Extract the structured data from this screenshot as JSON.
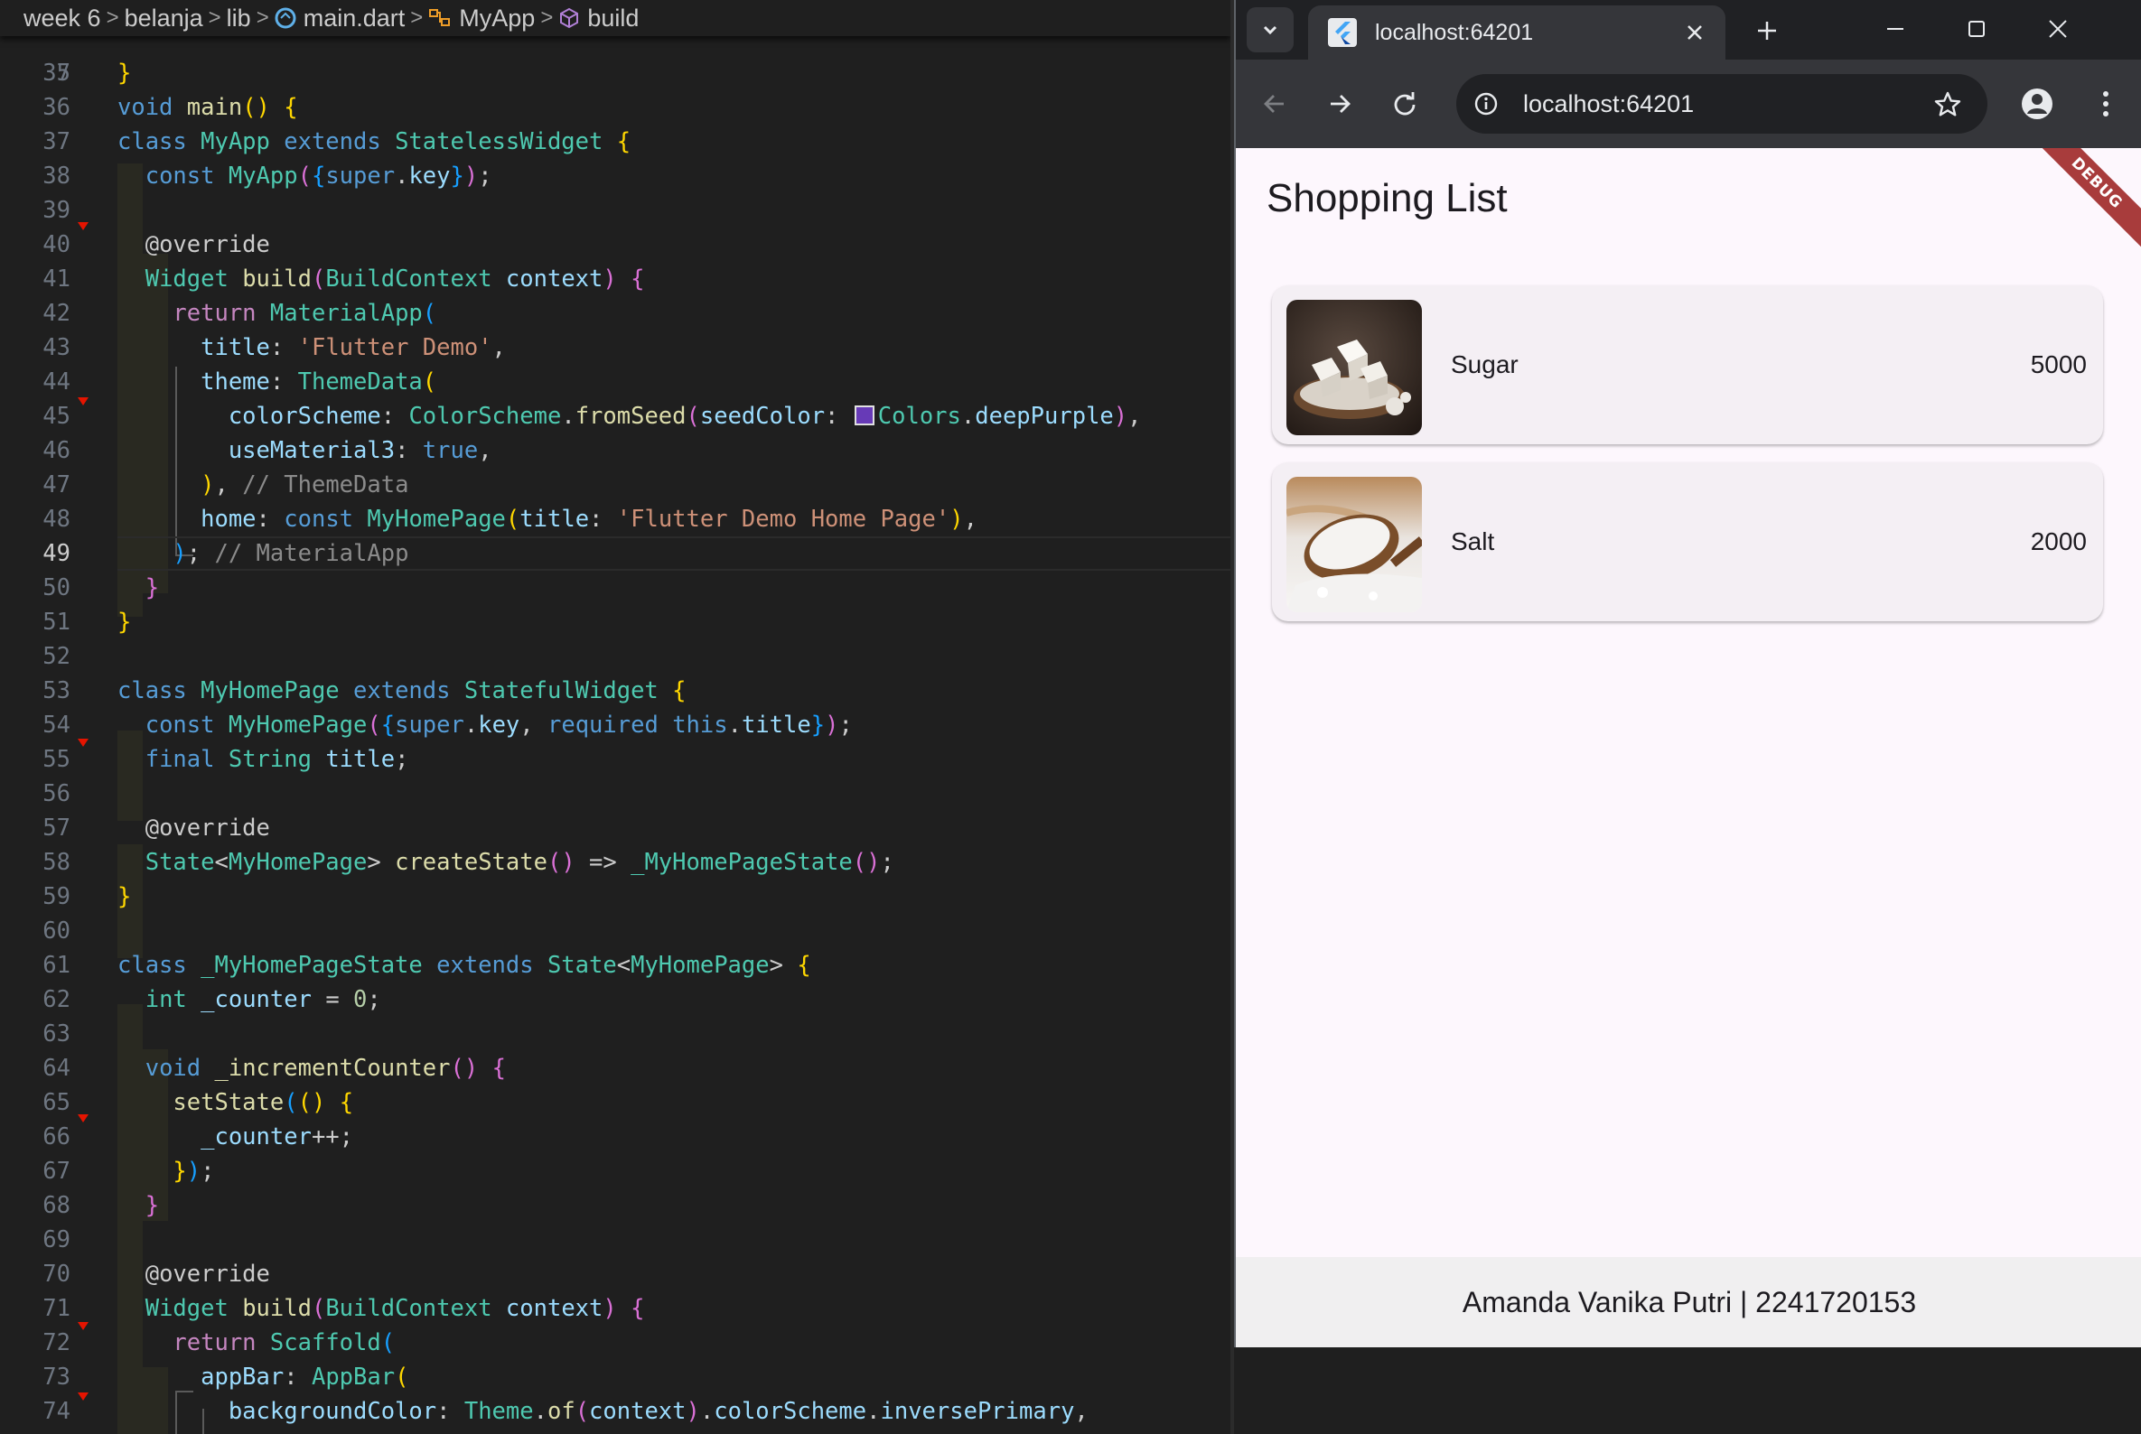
{
  "editor": {
    "breadcrumb": [
      "week 6",
      "belanja",
      "lib",
      "main.dart",
      "MyApp",
      "build"
    ],
    "partial_top_line": {
      "number": "7",
      "text": "void main() {"
    },
    "current_line": 49,
    "lines": [
      {
        "n": 35,
        "text": "}"
      },
      {
        "n": 36,
        "text": ""
      },
      {
        "n": 37,
        "text": "class MyApp extends StatelessWidget {"
      },
      {
        "n": 38,
        "text": "  const MyApp({super.key});"
      },
      {
        "n": 39,
        "text": ""
      },
      {
        "n": 40,
        "text": "  @override"
      },
      {
        "n": 41,
        "text": "  Widget build(BuildContext context) {"
      },
      {
        "n": 42,
        "text": "    return MaterialApp("
      },
      {
        "n": 43,
        "text": "      title: 'Flutter Demo',"
      },
      {
        "n": 44,
        "text": "      theme: ThemeData("
      },
      {
        "n": 45,
        "text": "        colorScheme: ColorScheme.fromSeed(seedColor: Colors.deepPurple),"
      },
      {
        "n": 46,
        "text": "        useMaterial3: true,"
      },
      {
        "n": 47,
        "text": "      ), // ThemeData"
      },
      {
        "n": 48,
        "text": "      home: const MyHomePage(title: 'Flutter Demo Home Page'),"
      },
      {
        "n": 49,
        "text": "    ); // MaterialApp"
      },
      {
        "n": 50,
        "text": "  }"
      },
      {
        "n": 51,
        "text": "}"
      },
      {
        "n": 52,
        "text": ""
      },
      {
        "n": 53,
        "text": "class MyHomePage extends StatefulWidget {"
      },
      {
        "n": 54,
        "text": "  const MyHomePage({super.key, required this.title});"
      },
      {
        "n": 55,
        "text": "  final String title;"
      },
      {
        "n": 56,
        "text": ""
      },
      {
        "n": 57,
        "text": "  @override"
      },
      {
        "n": 58,
        "text": "  State<MyHomePage> createState() => _MyHomePageState();"
      },
      {
        "n": 59,
        "text": "}"
      },
      {
        "n": 60,
        "text": ""
      },
      {
        "n": 61,
        "text": "class _MyHomePageState extends State<MyHomePage> {"
      },
      {
        "n": 62,
        "text": "  int _counter = 0;"
      },
      {
        "n": 63,
        "text": ""
      },
      {
        "n": 64,
        "text": "  void _incrementCounter() {"
      },
      {
        "n": 65,
        "text": "    setState(() {"
      },
      {
        "n": 66,
        "text": "      _counter++;"
      },
      {
        "n": 67,
        "text": "    });"
      },
      {
        "n": 68,
        "text": "  }"
      },
      {
        "n": 69,
        "text": ""
      },
      {
        "n": 70,
        "text": "  @override"
      },
      {
        "n": 71,
        "text": "  Widget build(BuildContext context) {"
      },
      {
        "n": 72,
        "text": "    return Scaffold("
      },
      {
        "n": 73,
        "text": "      appBar: AppBar("
      },
      {
        "n": 74,
        "text": "        backgroundColor: Theme.of(context).colorScheme.inversePrimary,"
      }
    ],
    "swatch_color": "#673ab7"
  },
  "browser": {
    "tab_title": "localhost:64201",
    "address": "localhost:64201",
    "icons": {
      "tab_search": "chevron-down-icon",
      "tab_close": "close-icon",
      "new_tab": "plus-icon",
      "minimize": "minimize-icon",
      "maximize": "maximize-icon",
      "close_window": "close-icon",
      "back": "arrow-left-icon",
      "forward": "arrow-right-icon",
      "reload": "reload-icon",
      "site_info": "info-icon",
      "bookmark": "star-icon",
      "profile": "person-icon",
      "menu": "kebab-menu-icon"
    }
  },
  "app": {
    "title": "Shopping List",
    "debug_banner": "DEBUG",
    "items": [
      {
        "name": "Sugar",
        "price": "5000",
        "image": "sugar cubes in wooden spoon"
      },
      {
        "name": "Salt",
        "price": "2000",
        "image": "salt in wooden spoon"
      }
    ],
    "footer": "Amanda Vanika Putri | 2241720153",
    "colors": {
      "background": "#fdf7fd",
      "card": "#f4eff4",
      "footer": "#f0eff0",
      "debug": "#a83c3c"
    }
  }
}
